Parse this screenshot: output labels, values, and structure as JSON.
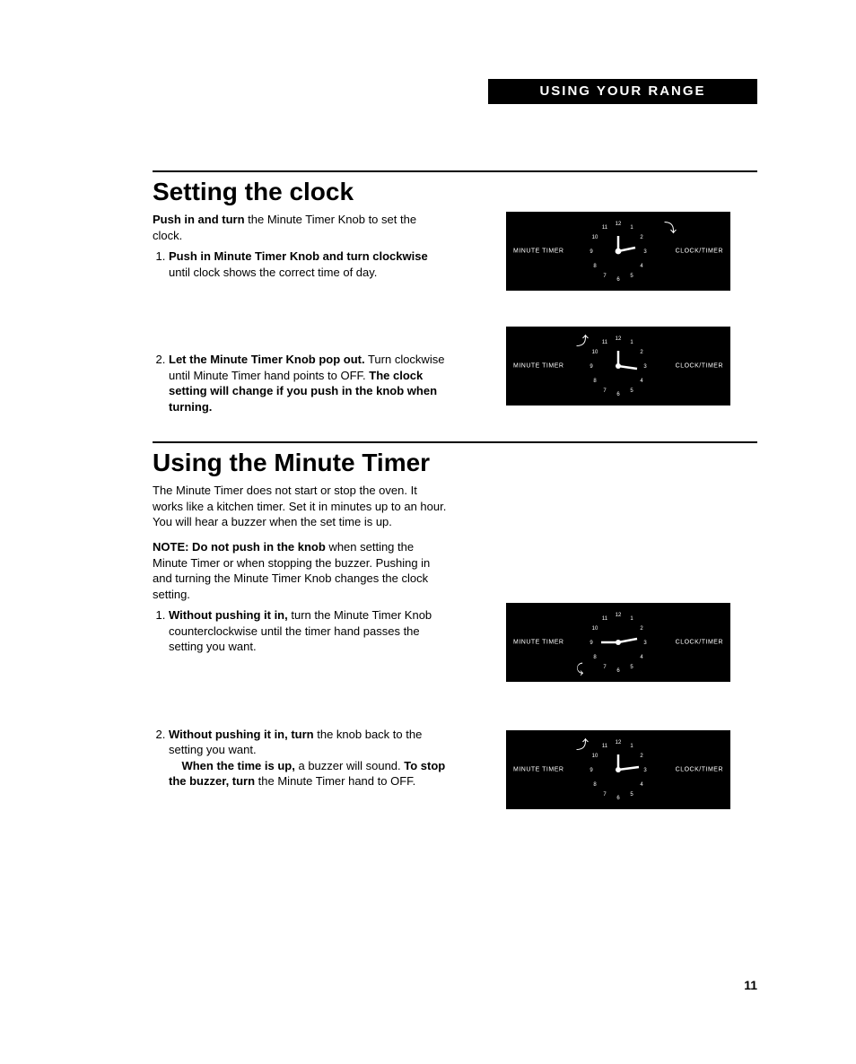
{
  "header": {
    "section_label": "USING YOUR RANGE"
  },
  "section1": {
    "title": "Setting the clock",
    "intro_bold": "Push in and turn",
    "intro_rest": " the Minute Timer Knob to set the clock.",
    "step1_bold1": "Push in Minute Timer Knob and turn clockwise",
    "step1_rest": " until clock shows the correct time of day.",
    "step2_bold1": "Let the Minute Timer Knob pop out.",
    "step2_mid": " Turn clockwise until Minute Timer hand points to OFF. ",
    "step2_bold2": "The clock setting will change if you push in the knob when turning."
  },
  "section2": {
    "title": "Using the Minute Timer",
    "intro": "The Minute Timer does not start or stop the oven. It works like a kitchen timer. Set it in minutes up to an hour. You will hear a buzzer when the set time is up.",
    "note_bold": "NOTE: Do not push in the knob",
    "note_rest": " when setting the Minute Timer or when stopping the buzzer. Pushing in and turning the Minute Timer Knob changes the clock setting.",
    "step1_bold": "Without pushing it in,",
    "step1_rest": " turn the Minute Timer Knob counterclockwise until the timer hand passes the setting you want.",
    "step2_bold1": "Without pushing it in, turn",
    "step2_rest1": " the knob back to the setting you want.",
    "step2_indent_bold": "When the time is up,",
    "step2_indent_rest": " a buzzer will sound. ",
    "step2_bold2": "To stop the buzzer, turn",
    "step2_rest2": " the Minute Timer hand to OFF."
  },
  "dial": {
    "left_label": "MINUTE TIMER",
    "right_label": "CLOCK/TIMER",
    "numbers": [
      "12",
      "1",
      "2",
      "3",
      "4",
      "5",
      "6",
      "7",
      "8",
      "9",
      "10",
      "11"
    ]
  },
  "arrows": {
    "cw": "↻",
    "ccw": "↺"
  },
  "page_number": "11"
}
